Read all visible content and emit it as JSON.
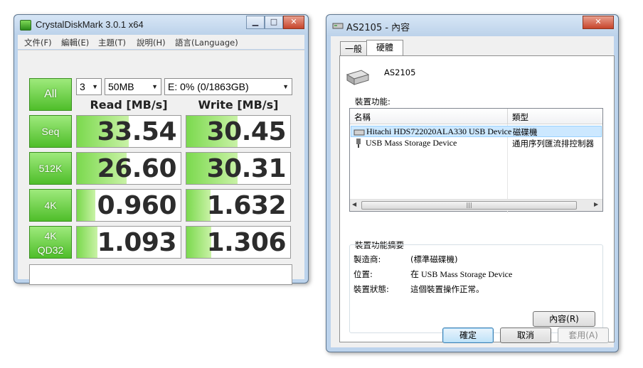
{
  "cdm": {
    "title": "CrystalDiskMark 3.0.1 x64",
    "menu": [
      "文件(F)",
      "編輯(E)",
      "主題(T)",
      "說明(H)",
      "語言(Language)"
    ],
    "all_label": "All",
    "runs": "3",
    "size": "50MB",
    "drive": "E: 0% (0/1863GB)",
    "read_header": "Read [MB/s]",
    "write_header": "Write [MB/s]",
    "comment": "",
    "rows": [
      {
        "label": "Seq",
        "read": "33.54",
        "write": "30.45"
      },
      {
        "label": "512K",
        "read": "26.60",
        "write": "30.31"
      },
      {
        "label": "4K",
        "read": "0.960",
        "write": "1.632"
      },
      {
        "label": "4K\nQD32",
        "read": "1.093",
        "write": "1.306"
      }
    ],
    "bar_fraction": {
      "read": [
        0.5,
        0.48,
        0.18,
        0.2
      ],
      "write": [
        0.49,
        0.49,
        0.23,
        0.24
      ]
    }
  },
  "prop": {
    "title": "AS2105 - 內容",
    "tabs": [
      "一般",
      "硬體"
    ],
    "device_name": "AS2105",
    "functions_label": "裝置功能:",
    "columns": [
      "名稱",
      "類型"
    ],
    "devices": [
      {
        "name": "Hitachi HDS722020ALA330 USB Device",
        "type": "磁碟機",
        "selected": true
      },
      {
        "name": "USB Mass Storage Device",
        "type": "通用序列匯流排控制器",
        "selected": false
      }
    ],
    "summary_label": "裝置功能摘要",
    "summary": [
      {
        "key": "製造商:",
        "value": "(標準磁碟機)"
      },
      {
        "key": "位置:",
        "value": "在 USB Mass Storage Device"
      },
      {
        "key": "裝置狀態:",
        "value": "這個裝置操作正常。"
      }
    ],
    "properties_button": "內容(R)",
    "ok": "確定",
    "cancel": "取消",
    "apply": "套用(A)"
  }
}
